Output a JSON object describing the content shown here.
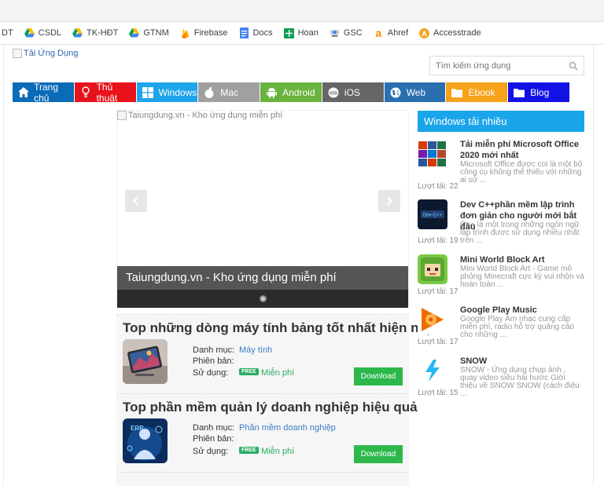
{
  "bookmarks": [
    {
      "label": "DT",
      "icon": "none",
      "color": "#888"
    },
    {
      "label": "CSDL",
      "icon": "google-drive-icon",
      "color": "#fbbc04"
    },
    {
      "label": "TK-HĐT",
      "icon": "google-drive-icon",
      "color": "#fbbc04"
    },
    {
      "label": "GTNM",
      "icon": "google-drive-icon",
      "color": "#fbbc04"
    },
    {
      "label": "Firebase",
      "icon": "firebase-icon",
      "color": "#ffa000"
    },
    {
      "label": "Docs",
      "icon": "google-docs-icon",
      "color": "#4285f4"
    },
    {
      "label": "Hoan",
      "icon": "google-sheets-icon",
      "color": "#0f9d58"
    },
    {
      "label": "GSC",
      "icon": "search-console-icon",
      "color": "#5f6368"
    },
    {
      "label": "Ahref",
      "icon": "ahrefs-icon",
      "color": "#ff8800"
    },
    {
      "label": "Accesstrade",
      "icon": "accesstrade-icon",
      "color": "#f5a623"
    }
  ],
  "header": {
    "logo_alt": "Tải Ứng Dụng",
    "search_placeholder": "Tìm kiếm ứng dụng"
  },
  "nav": [
    {
      "label": "Trang chủ",
      "icon": "home-icon",
      "color": "#0a6bb8"
    },
    {
      "label": "Thủ thuật",
      "icon": "lightbulb-icon",
      "color": "#e8121a"
    },
    {
      "label": "Windows",
      "icon": "windows-icon",
      "color": "#1ea4ea"
    },
    {
      "label": "Mac",
      "icon": "apple-icon",
      "color": "#a0a0a0"
    },
    {
      "label": "Android",
      "icon": "android-icon",
      "color": "#6ab33e"
    },
    {
      "label": "iOS",
      "icon": "ios-icon",
      "color": "#666666"
    },
    {
      "label": "Web",
      "icon": "globe-icon",
      "color": "#2a6fb0"
    },
    {
      "label": "Ebook",
      "icon": "folder-icon",
      "color": "#f7a21a"
    },
    {
      "label": "Blog",
      "icon": "folder-icon",
      "color": "#1212e6"
    }
  ],
  "slider": {
    "image_alt": "Taiungdung.vn - Kho ứng dụng miễn phí",
    "caption": "Taiungdung.vn - Kho ứng dụng miễn phí"
  },
  "posts": [
    {
      "title": "Top những dòng máy tính bảng tốt nhất hiện nay",
      "category_label": "Danh mục:",
      "category": "Máy tính",
      "version_label": "Phiên bản:",
      "usage_label": "Sử dụng:",
      "free_badge": "FREE",
      "usage": "Miễn phí",
      "download": "Download"
    },
    {
      "title": "Top phần mềm quản lý doanh nghiệp hiệu quả",
      "category_label": "Danh mục:",
      "category": "Phần mềm doanh nghiệp",
      "version_label": "Phiên bản:",
      "usage_label": "Sử dụng:",
      "free_badge": "FREE",
      "usage": "Miễn phí",
      "download": "Download"
    }
  ],
  "sidebar": {
    "heading": "Windows tải nhiều",
    "items": [
      {
        "title": "Tải miễn phí Microsoft Office 2020 mới nhất",
        "desc": "Microsoft Office được coi là một bộ công cụ không thể thiếu với những ai sử ...",
        "count": "Lượt tải: 22"
      },
      {
        "title": "Dev C++phần mềm lập trình đơn giản cho người mới bắt đầu",
        "desc": "C++ là một trong những ngôn ngữ lập trình được sử dụng nhiều nhất trên ...",
        "count": "Lượt tải: 19"
      },
      {
        "title": "Mini World Block Art",
        "desc": "Mini World Block Art - Game mô phỏng Minecraft cực kỳ vui nhộn và hoàn toàn ...",
        "count": "Lượt tải: 17"
      },
      {
        "title": "Google Play Music",
        "desc": "Google Play Âm nhạc cung cấp miễn phí, radio hỗ trợ quảng cáo cho những ...",
        "count": "Lượt tải: 17"
      },
      {
        "title": "SNOW",
        "desc": "SNOW - Ứng dụng chụp ảnh , quay video siêu hài hước Giới thiệu về SNOW SNOW (cách điệu ...",
        "count": "Lượt tải: 15"
      }
    ]
  }
}
